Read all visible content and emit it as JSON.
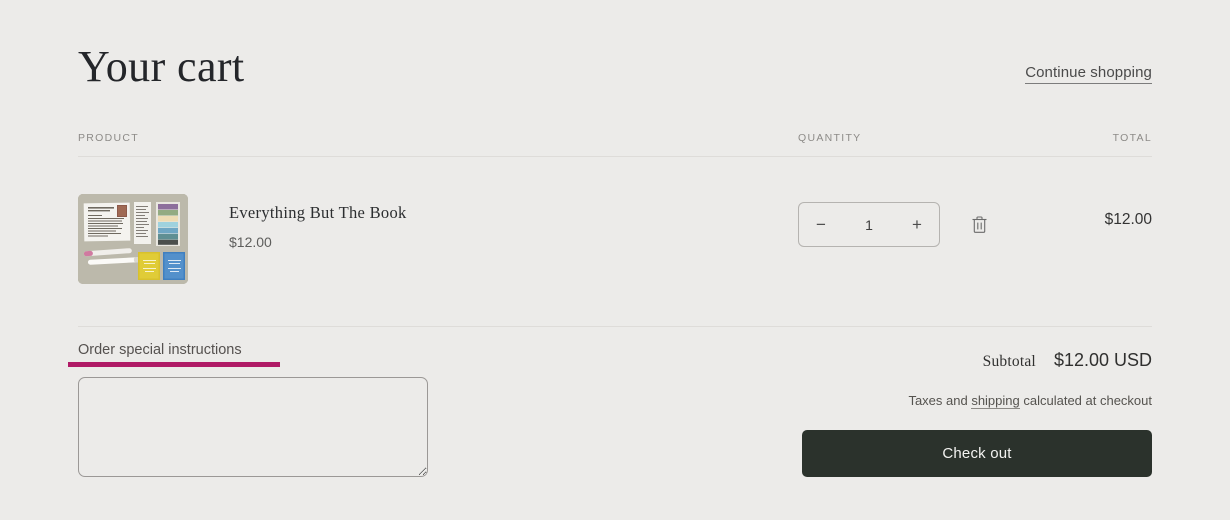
{
  "header": {
    "title": "Your cart",
    "continue_shopping": "Continue shopping"
  },
  "table": {
    "columns": {
      "product": "PRODUCT",
      "quantity": "QUANTITY",
      "total": "TOTAL"
    },
    "rows": [
      {
        "title": "Everything But The Book",
        "price": "$12.00",
        "quantity": "1",
        "line_total": "$12.00",
        "decrease_label": "−",
        "increase_label": "+",
        "remove_icon": "trash-icon",
        "thumbnail_alt": "Everything But The Book product photo"
      }
    ]
  },
  "notes": {
    "label": "Order special instructions",
    "value": "",
    "placeholder": "",
    "highlight_color": "#b01a66"
  },
  "totals": {
    "subtotal_label": "Subtotal",
    "subtotal_value": "$12.00 USD",
    "tax_note_prefix": "Taxes and ",
    "tax_note_link": "shipping",
    "tax_note_suffix": " calculated at checkout",
    "checkout_label": "Check out",
    "checkout_color": "#2b322c"
  }
}
